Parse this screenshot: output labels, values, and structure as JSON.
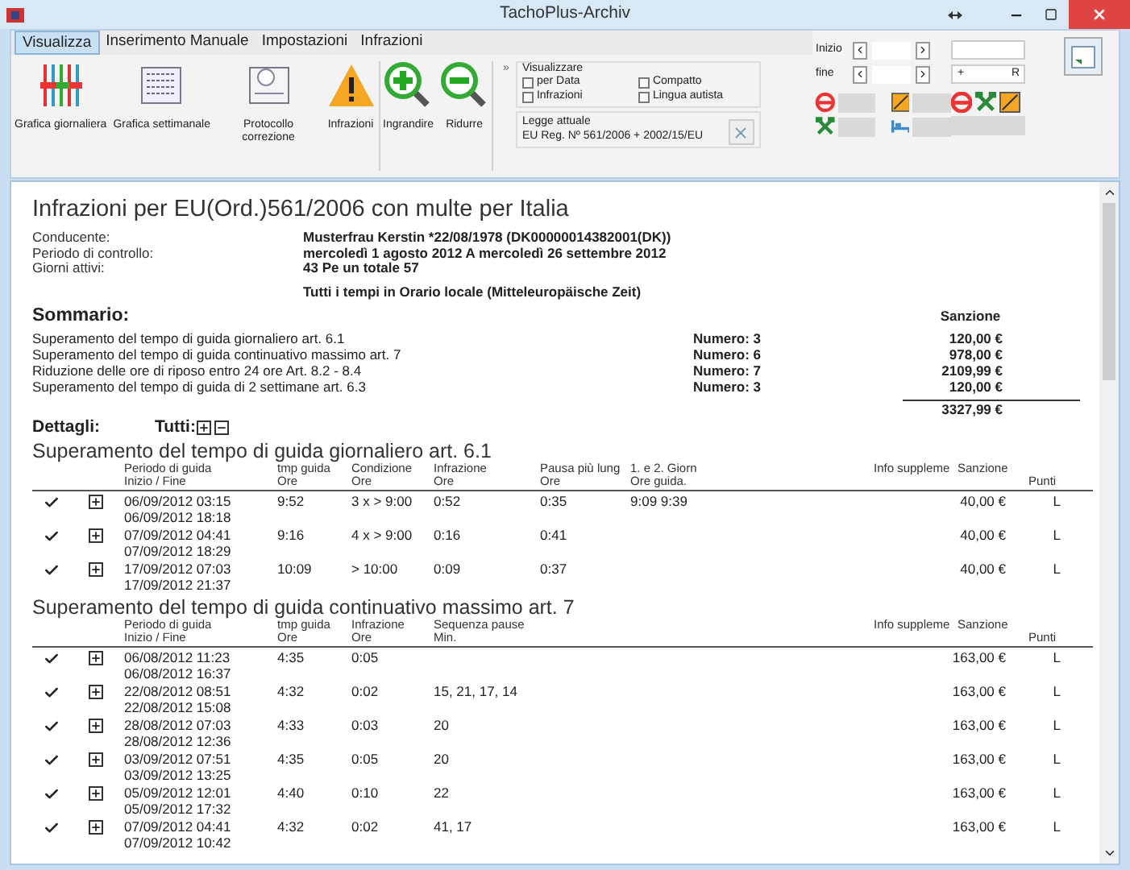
{
  "window": {
    "title": "TachoPlus-Archiv"
  },
  "tabs": [
    {
      "label": "Visualizza",
      "selected": true
    },
    {
      "label": "Inserimento Manuale",
      "selected": false
    },
    {
      "label": "Impostazioni",
      "selected": false
    },
    {
      "label": "Infrazioni",
      "selected": false
    }
  ],
  "ribbon": {
    "groups": [
      [
        {
          "label": "Grafica giornaliera",
          "kind": "daily"
        },
        {
          "label": "Grafica settimanale",
          "kind": "weekly"
        },
        {
          "label": "Protocollo correzione",
          "kind": "protocol"
        },
        {
          "label": "Infrazioni",
          "kind": "warning"
        }
      ],
      [
        {
          "label": "Ingrandire",
          "kind": "zoomin"
        },
        {
          "label": "Ridurre",
          "kind": "zoomout"
        }
      ]
    ],
    "more": "»",
    "view": {
      "title": "Visualizzare",
      "options": [
        {
          "label": "per Data",
          "checked": false
        },
        {
          "label": "Compatto",
          "checked": false
        },
        {
          "label": "Infrazioni",
          "checked": false
        },
        {
          "label": "Lingua autista",
          "checked": false
        }
      ]
    },
    "law": {
      "title": "Legge attuale",
      "value": "EU Reg. Nº 561/2006 + 2002/15/EU"
    },
    "range": {
      "start_label": "Inizio",
      "end_label": "fine",
      "plus": "+",
      "reset": "R"
    }
  },
  "report": {
    "title": "Infrazioni per EU(Ord.)561/2006 con multe per Italia",
    "info": [
      {
        "label": "Conducente:",
        "value": "Musterfrau Kerstin *22/08/1978  (DK00000014382001(DK))"
      },
      {
        "label": "Periodo di controllo:",
        "value": "mercoledì 1 agosto 2012 A mercoledì 26 settembre 2012"
      },
      {
        "label": "Giorni attivi:",
        "value": "43 Pe un totale 57"
      }
    ],
    "timezone_note": "Tutti i tempi in Orario locale (Mitteleuropäische Zeit)",
    "summary": {
      "title": "Sommario:",
      "sanction_header": "Sanzione",
      "total": "3327,99 €",
      "rows": [
        {
          "label": "Superamento del tempo di guida giornaliero art.  6.1",
          "count": "Numero: 3",
          "amount": "120,00 €"
        },
        {
          "label": "Superamento del tempo di guida continuativo massimo  art.  7",
          "count": "Numero: 6",
          "amount": "978,00 €"
        },
        {
          "label": "Riduzione delle ore di riposo entro 24 ore Art. 8.2 - 8.4",
          "count": "Numero: 7",
          "amount": "2109,99 €"
        },
        {
          "label": "Superamento del tempo di guida di 2 settimane art. 6.3",
          "count": "Numero: 3",
          "amount": "120,00 €"
        }
      ]
    },
    "details": {
      "label": "Dettagli:",
      "all_label": "Tutti:"
    },
    "sections": [
      {
        "title": "Superamento del tempo di guida giornaliero art.  6.1",
        "period_column": {
          "label": "Periodo di guida",
          "unit": "Inizio / Fine"
        },
        "columns": [
          {
            "label": "tmp guida",
            "unit": "Ore"
          },
          {
            "label": "Condizione",
            "unit": "Ore"
          },
          {
            "label": "Infrazione",
            "unit": "Ore"
          },
          {
            "label": "Pausa più lung",
            "unit": "Ore"
          },
          {
            "label": "1. e 2. Giorn",
            "unit": "Ore guida."
          }
        ],
        "info_header": "Info suppleme",
        "sanction_header": "Sanzione",
        "points_header": "Punti",
        "rows": [
          {
            "checked": true,
            "start": "06/09/2012 03:15",
            "end": "06/09/2012 18:18",
            "cells": [
              "9:52",
              "3 x > 9:00",
              "0:52",
              "0:35",
              "9:09 9:39"
            ],
            "amount": "40,00 €",
            "points": "L"
          },
          {
            "checked": true,
            "start": "07/09/2012 04:41",
            "end": "07/09/2012 18:29",
            "cells": [
              "9:16",
              "4 x > 9:00",
              "0:16",
              "0:41"
            ],
            "amount": "40,00 €",
            "points": "L"
          },
          {
            "checked": true,
            "start": "17/09/2012 07:03",
            "end": "17/09/2012 21:37",
            "cells": [
              "10:09",
              "> 10:00",
              "0:09",
              "0:37"
            ],
            "amount": "40,00 €",
            "points": "L"
          }
        ]
      },
      {
        "title": "Superamento del tempo di guida continuativo massimo  art.  7",
        "period_column": {
          "label": "Periodo di guida",
          "unit": "Inizio / Fine"
        },
        "columns": [
          {
            "label": "tmp guida",
            "unit": "Ore"
          },
          {
            "label": "Infrazione",
            "unit": "Ore"
          },
          {
            "label": "Sequenza pause",
            "unit": "Min."
          }
        ],
        "info_header": "Info suppleme",
        "sanction_header": "Sanzione",
        "points_header": "Punti",
        "rows": [
          {
            "checked": true,
            "start": "06/08/2012 11:23",
            "end": "06/08/2012 16:37",
            "cells": [
              "4:35",
              "0:05"
            ],
            "amount": "163,00 €",
            "points": "L"
          },
          {
            "checked": true,
            "start": "22/08/2012 08:51",
            "end": "22/08/2012 15:08",
            "cells": [
              "4:32",
              "0:02",
              "15, 21, 17, 14"
            ],
            "amount": "163,00 €",
            "points": "L"
          },
          {
            "checked": true,
            "start": "28/08/2012 07:03",
            "end": "28/08/2012 12:36",
            "cells": [
              "4:33",
              "0:03",
              "20"
            ],
            "amount": "163,00 €",
            "points": "L"
          },
          {
            "checked": true,
            "start": "03/09/2012 07:51",
            "end": "03/09/2012 13:25",
            "cells": [
              "4:35",
              "0:05",
              "20"
            ],
            "amount": "163,00 €",
            "points": "L"
          },
          {
            "checked": true,
            "start": "05/09/2012 12:01",
            "end": "05/09/2012 17:32",
            "cells": [
              "4:40",
              "0:10",
              "22"
            ],
            "amount": "163,00 €",
            "points": "L"
          },
          {
            "checked": true,
            "start": "07/09/2012 04:41",
            "end": "07/09/2012 10:42",
            "cells": [
              "4:32",
              "0:02",
              "41, 17"
            ],
            "amount": "163,00 €",
            "points": "L"
          }
        ]
      }
    ]
  }
}
